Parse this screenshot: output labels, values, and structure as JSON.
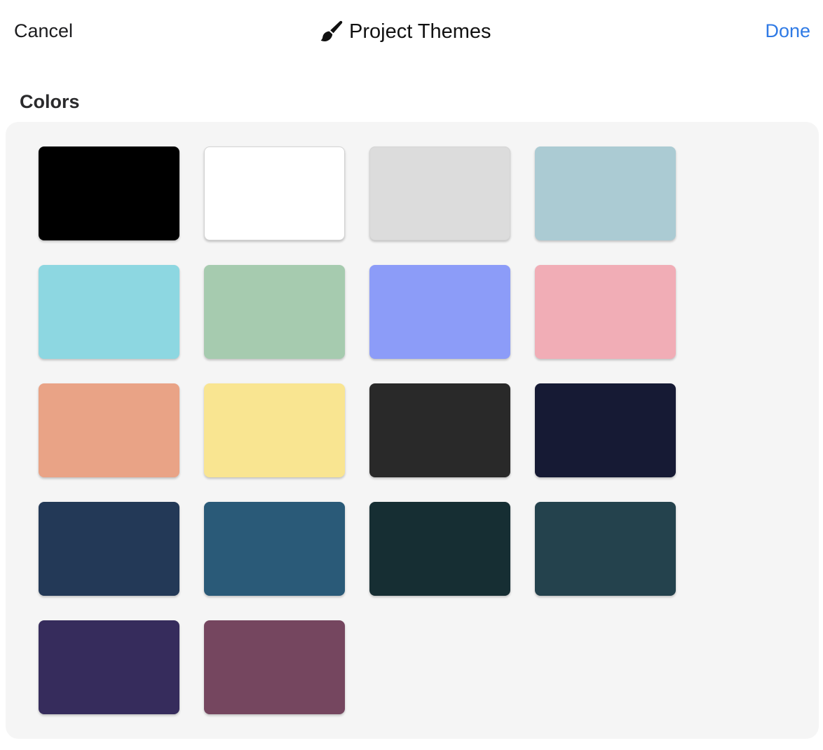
{
  "nav": {
    "cancel_label": "Cancel",
    "title": "Project Themes",
    "done_label": "Done",
    "title_icon": "paintbrush-icon",
    "accent_color": "#2f7ae5"
  },
  "section": {
    "header": "Colors"
  },
  "swatches": [
    {
      "color": "#000000"
    },
    {
      "color": "#ffffff"
    },
    {
      "color": "#dcdcdc"
    },
    {
      "color": "#abcbd3"
    },
    {
      "color": "#8dd7e1"
    },
    {
      "color": "#a6cbaf"
    },
    {
      "color": "#8c9cf8"
    },
    {
      "color": "#f1adb6"
    },
    {
      "color": "#e9a386"
    },
    {
      "color": "#f9e591"
    },
    {
      "color": "#292929"
    },
    {
      "color": "#161a34"
    },
    {
      "color": "#233957"
    },
    {
      "color": "#2a5a78"
    },
    {
      "color": "#162e33"
    },
    {
      "color": "#24424d"
    },
    {
      "color": "#362c5c"
    },
    {
      "color": "#75465f"
    }
  ]
}
